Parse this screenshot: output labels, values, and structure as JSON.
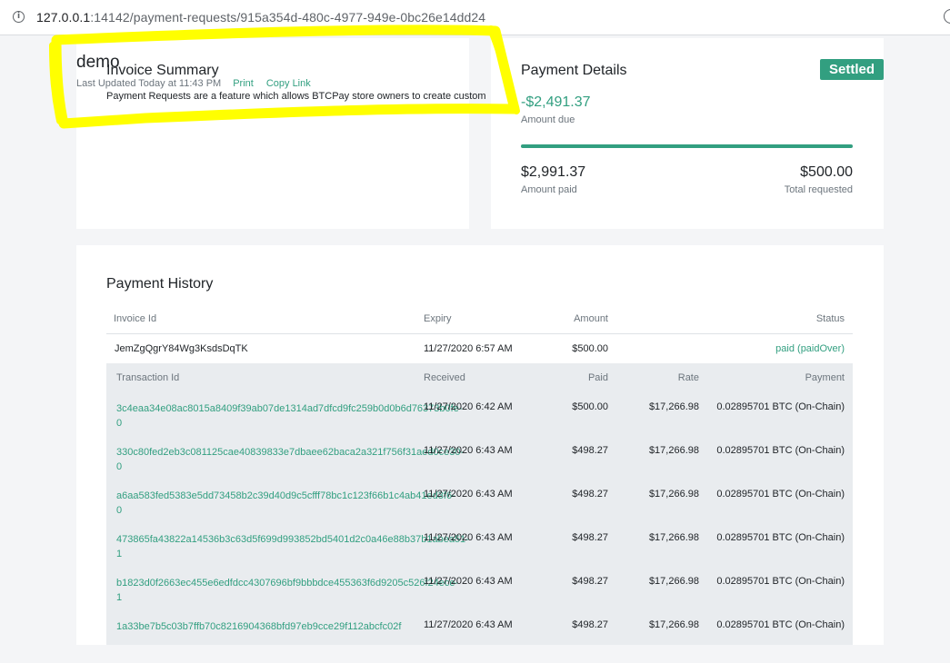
{
  "browser": {
    "url_host": "127.0.0.1",
    "url_path": ":14142/payment-requests/915a354d-480c-4977-949e-0bc26e14dd24"
  },
  "summary": {
    "store_name": "demo",
    "title": "Invoice Summary",
    "last_updated": "Last Updated Today at 11:43 PM",
    "print_label": "Print",
    "copy_link_label": "Copy Link",
    "description": "Payment Requests are a feature which allows BTCPay store owners to create custom"
  },
  "details": {
    "title": "Payment Details",
    "status_badge": "Settled",
    "amount_due": "-$2,491.37",
    "amount_due_label": "Amount due",
    "progress_fraction": 1.0,
    "amount_paid": "$2,991.37",
    "amount_paid_label": "Amount paid",
    "total_requested": "$500.00",
    "total_requested_label": "Total requested"
  },
  "history": {
    "title": "Payment History",
    "columns": {
      "invoice_id": "Invoice Id",
      "expiry": "Expiry",
      "amount": "Amount",
      "status": "Status"
    },
    "invoice": {
      "id": "JemZgQgrY84Wg3KsdsDqTK",
      "expiry": "11/27/2020 6:57 AM",
      "amount": "$500.00",
      "status": "paid (paidOver)"
    },
    "tx_columns": {
      "transaction_id": "Transaction Id",
      "received": "Received",
      "paid": "Paid",
      "rate": "Rate",
      "payment": "Payment"
    },
    "transactions": [
      {
        "id": "3c4eaa34e08ac8015a8409f39ab07de1314ad7dfcd9fc259b0d0b6d76373b0fe-0",
        "received": "11/27/2020 6:42 AM",
        "paid": "$500.00",
        "rate": "$17,266.98",
        "payment": "0.02895701 BTC (On-Chain)"
      },
      {
        "id": "330c80fed2eb3c081125cae40839833e7dbaee62baca2a321f756f31aed0ce30-0",
        "received": "11/27/2020 6:43 AM",
        "paid": "$498.27",
        "rate": "$17,266.98",
        "payment": "0.02895701 BTC (On-Chain)"
      },
      {
        "id": "a6aa583fed5383e5dd73458b2c39d40d9c5cfff78bc1c123f66b1c4ab41ed3f6-0",
        "received": "11/27/2020 6:43 AM",
        "paid": "$498.27",
        "rate": "$17,266.98",
        "payment": "0.02895701 BTC (On-Chain)"
      },
      {
        "id": "473865fa43822a14536b3c63d5f699d993852bd5401d2c0a46e88b37b1abea51-1",
        "received": "11/27/2020 6:43 AM",
        "paid": "$498.27",
        "rate": "$17,266.98",
        "payment": "0.02895701 BTC (On-Chain)"
      },
      {
        "id": "b1823d0f2663ec455e6edfdcc4307696bf9bbbdce455363f6d9205c526f24ece-1",
        "received": "11/27/2020 6:43 AM",
        "paid": "$498.27",
        "rate": "$17,266.98",
        "payment": "0.02895701 BTC (On-Chain)"
      },
      {
        "id": "1a33be7b5c03b7ffb70c8216904368bfd97eb9cce29f112abcfc02f",
        "received": "11/27/2020 6:43 AM",
        "paid": "$498.27",
        "rate": "$17,266.98",
        "payment": "0.02895701 BTC (On-Chain)"
      }
    ]
  },
  "colors": {
    "accent": "#329f80",
    "highlight": "#ffff00"
  }
}
